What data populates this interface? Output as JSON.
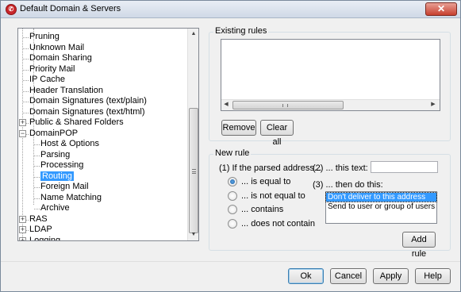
{
  "window": {
    "title": "Default Domain & Servers",
    "close_glyph": "✕",
    "app_icon": "mdaemon-icon",
    "app_icon_glyph": "✆"
  },
  "tree": {
    "items": [
      {
        "label": "Pruning",
        "level": 1
      },
      {
        "label": "Unknown Mail",
        "level": 1
      },
      {
        "label": "Domain Sharing",
        "level": 1
      },
      {
        "label": "Priority Mail",
        "level": 1
      },
      {
        "label": "IP Cache",
        "level": 1
      },
      {
        "label": "Header Translation",
        "level": 1
      },
      {
        "label": "Domain Signatures (text/plain)",
        "level": 1
      },
      {
        "label": "Domain Signatures (text/html)",
        "level": 1
      },
      {
        "label": "Public & Shared Folders",
        "level": 1,
        "expander": "+"
      },
      {
        "label": "DomainPOP",
        "level": 1,
        "expander": "−"
      },
      {
        "label": "Host & Options",
        "level": 2
      },
      {
        "label": "Parsing",
        "level": 2
      },
      {
        "label": "Processing",
        "level": 2
      },
      {
        "label": "Routing",
        "level": 2,
        "selected": true
      },
      {
        "label": "Foreign Mail",
        "level": 2
      },
      {
        "label": "Name Matching",
        "level": 2
      },
      {
        "label": "Archive",
        "level": 2
      },
      {
        "label": "RAS",
        "level": 0,
        "expander": "+"
      },
      {
        "label": "LDAP",
        "level": 0,
        "expander": "+"
      },
      {
        "label": "Logging",
        "level": 0,
        "expander": "+"
      }
    ],
    "scroll_up_glyph": "▲",
    "scroll_down_glyph": "▼"
  },
  "existing_rules": {
    "group_label": "Existing rules",
    "scroll_left_glyph": "◀",
    "scroll_right_glyph": "▶",
    "remove_label": "Remove",
    "clear_all_label": "Clear all"
  },
  "new_rule": {
    "group_label": "New rule",
    "step1_label": "(1)  If the parsed address...",
    "step2_label": "(2)  ... this text:",
    "step3_label": "(3)  ... then do this:",
    "text_value": "",
    "options": [
      {
        "label": "... is equal to",
        "checked": true
      },
      {
        "label": "... is not equal to",
        "checked": false
      },
      {
        "label": "... contains",
        "checked": false
      },
      {
        "label": "... does not contain",
        "checked": false
      }
    ],
    "actions": [
      {
        "label": "Don't deliver to this address",
        "selected": true
      },
      {
        "label": "Send to user or group of users",
        "selected": false
      }
    ],
    "add_rule_label": "Add rule"
  },
  "footer": {
    "ok_label": "Ok",
    "cancel_label": "Cancel",
    "apply_label": "Apply",
    "help_label": "Help"
  }
}
